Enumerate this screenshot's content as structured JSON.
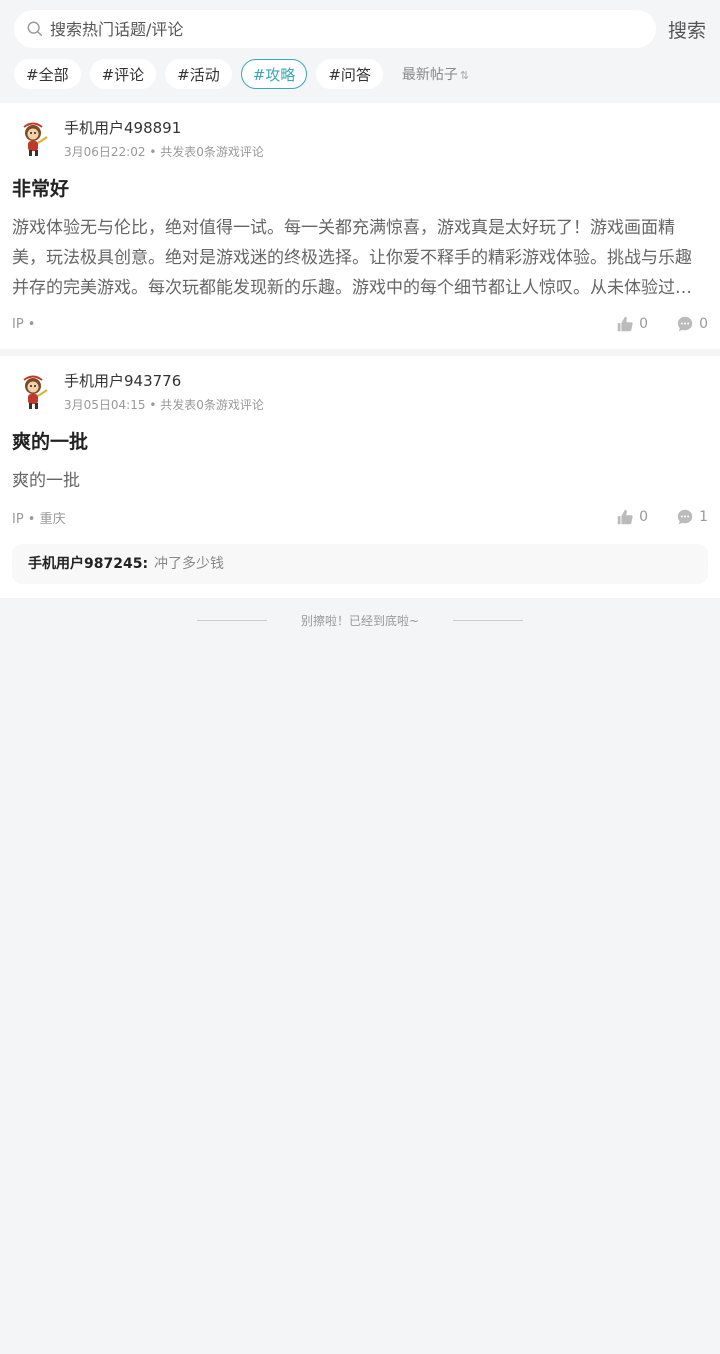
{
  "search": {
    "placeholder": "搜索热门话题/评论",
    "button": "搜索"
  },
  "tags": [
    "#全部",
    "#评论",
    "#活动",
    "#攻略",
    "#问答"
  ],
  "active_tag": "#攻略",
  "sort": {
    "label": "最新帖子",
    "icon": "sort-arrows-icon"
  },
  "posts": [
    {
      "user": "手机用户498891",
      "time": "3月06日22:02",
      "count_text": "共发表0条游戏评论",
      "title": "非常好",
      "body": "游戏体验无与伦比，绝对值得一试。每一关都充满惊喜，游戏真是太好玩了！游戏画面精美，玩法极具创意。绝对是游戏迷的终极选择。让你爱不释手的精彩游戏体验。挑战与乐趣并存的完美游戏。每次玩都能发现新的乐趣。游戏中的每个细节都让人惊叹。从未体验过如此精彩的游戏",
      "ip": "IP •",
      "likes": "0",
      "comments": "0"
    },
    {
      "user": "手机用户943776",
      "time": "3月05日04:15",
      "count_text": "共发表0条游戏评论",
      "title": "爽的一批",
      "body": "爽的一批",
      "ip": "IP • 重庆",
      "likes": "0",
      "comments": "1",
      "reply": {
        "user": "手机用户987245:",
        "text": "冲了多少钱"
      }
    }
  ],
  "end_text": "别擦啦！已经到底啦~",
  "colors": {
    "accent": "#3aa6b9",
    "background": "#f4f5f7"
  }
}
